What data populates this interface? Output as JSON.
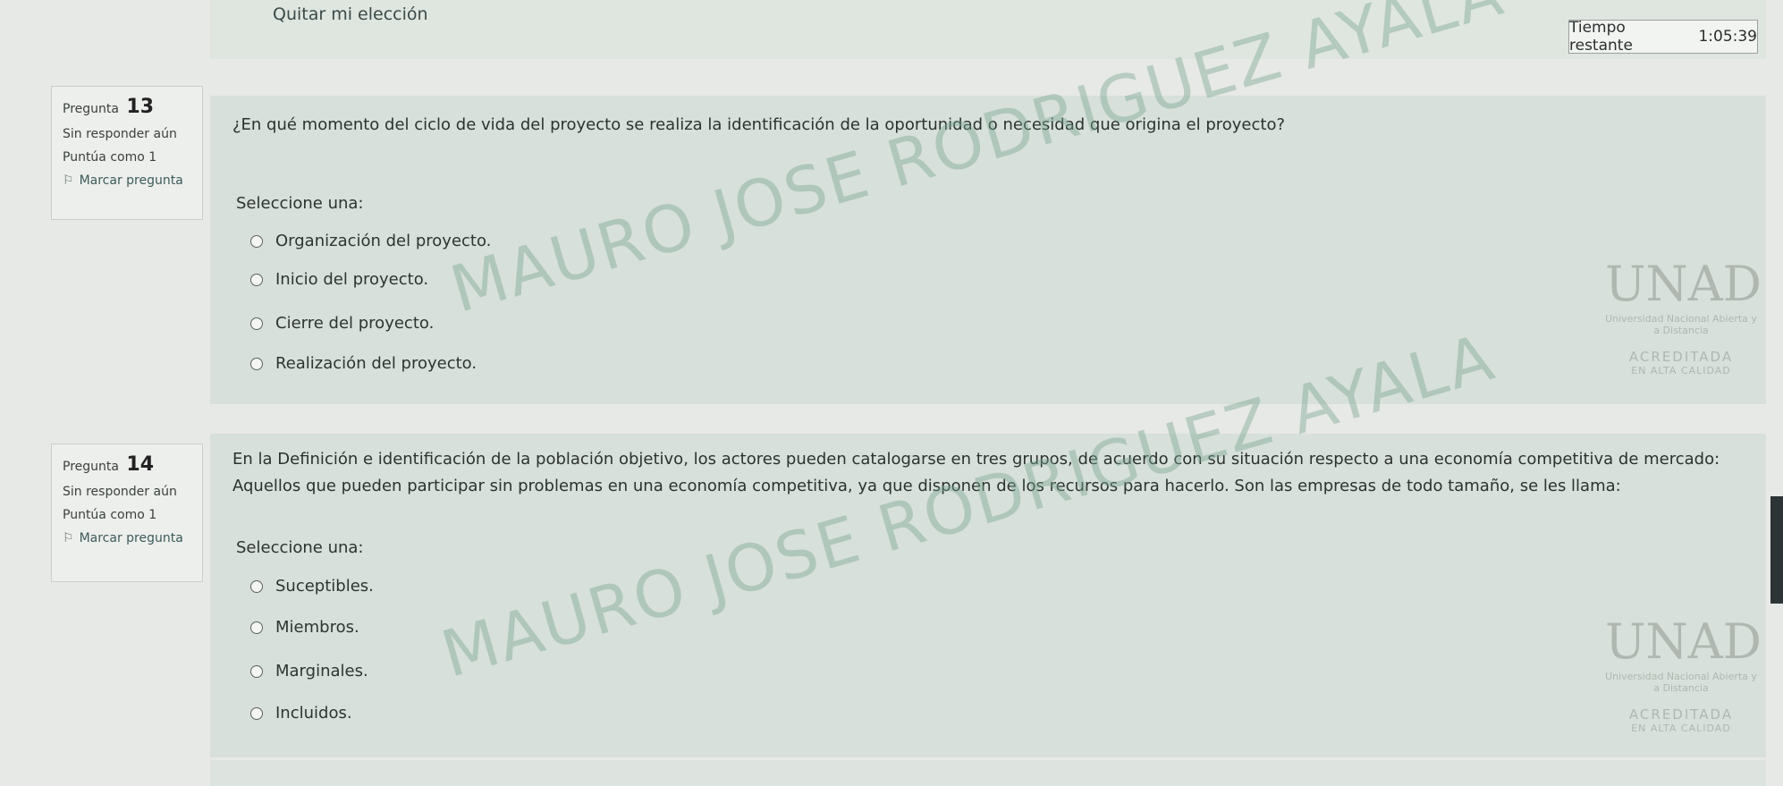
{
  "header": {
    "clear_choice": "Quitar mi elección",
    "timer_label": "Tiempo restante",
    "timer_value": "1:05:39"
  },
  "watermark_text": "MAURO JOSE RODRIGUEZ AYALA",
  "logo": {
    "mark": "UNAD",
    "subtitle": "Universidad Nacional Abierta y a Distancia",
    "accredited": "ACREDITADA",
    "quality": "EN ALTA CALIDAD"
  },
  "questions": [
    {
      "label": "Pregunta",
      "number": "13",
      "status": "Sin responder aún",
      "score": "Puntúa como 1",
      "flag_label": "Marcar pregunta",
      "text": "¿En qué momento del ciclo de vida del proyecto se realiza la identificación de la oportunidad o necesidad que origina el proyecto?",
      "select_label": "Seleccione una:",
      "options": [
        "Organización del proyecto.",
        "Inicio del proyecto.",
        "Cierre del proyecto.",
        "Realización del proyecto."
      ]
    },
    {
      "label": "Pregunta",
      "number": "14",
      "status": "Sin responder aún",
      "score": "Puntúa como 1",
      "flag_label": "Marcar pregunta",
      "text": "En la Definición e identificación de la población objetivo, los actores pueden catalogarse en tres grupos, de acuerdo con su situación respecto a una economía competitiva de mercado: Aquellos que pueden participar sin problemas en una economía competitiva, ya que disponen de los recursos para hacerlo. Son las empresas de todo tamaño, se les llama:",
      "select_label": "Seleccione una:",
      "options": [
        "Suceptibles.",
        "Miembros.",
        "Marginales.",
        "Incluidos."
      ]
    }
  ]
}
